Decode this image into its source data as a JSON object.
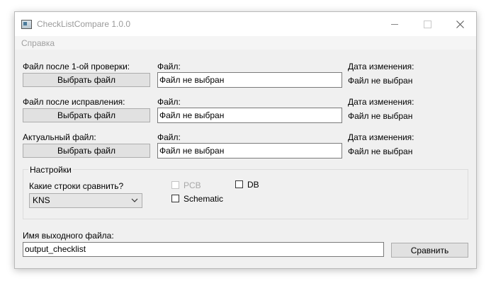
{
  "window": {
    "title": "CheckListCompare 1.0.0"
  },
  "menu": {
    "help": "Справка"
  },
  "rows": [
    {
      "section_label": "Файл после 1-ой проверки:",
      "button": "Выбрать файл",
      "file_label": "Файл:",
      "file_value": "Файл не выбран",
      "date_label": "Дата изменения:",
      "date_value": "Файл не выбран"
    },
    {
      "section_label": "Файл после исправления:",
      "button": "Выбрать файл",
      "file_label": "Файл:",
      "file_value": "Файл не выбран",
      "date_label": "Дата изменения:",
      "date_value": "Файл не выбран"
    },
    {
      "section_label": "Актуальный файл:",
      "button": "Выбрать файл",
      "file_label": "Файл:",
      "file_value": "Файл не выбран",
      "date_label": "Дата изменения:",
      "date_value": "Файл не выбран"
    }
  ],
  "settings": {
    "title": "Настройки",
    "compare_label": "Какие строки сравнить?",
    "compare_selected": "KNS",
    "options": [
      {
        "label": "PCB",
        "checked": false,
        "disabled": true
      },
      {
        "label": "DB",
        "checked": false,
        "disabled": false
      },
      {
        "label": "Schematic",
        "checked": false,
        "disabled": false
      }
    ]
  },
  "output": {
    "label": "Имя выходного файла:",
    "value": "output_checklist",
    "compare_button": "Сравнить"
  }
}
